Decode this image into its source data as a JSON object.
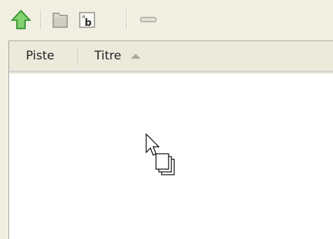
{
  "toolbar": {
    "buttons": [
      {
        "icon": "arrow-up-icon",
        "color": "#39a935"
      },
      {
        "icon": "folder-icon"
      },
      {
        "icon": "rename-ab-icon",
        "glyph_small": "a",
        "glyph_large": "b"
      },
      {
        "icon": "minus-icon"
      }
    ]
  },
  "list": {
    "columns": [
      {
        "label": "Piste"
      },
      {
        "label": "Titre",
        "sorted": "ascending"
      }
    ],
    "rows": []
  },
  "cursor": {
    "icon": "drag-multiple-files-cursor-icon"
  },
  "colors": {
    "background": "#f1efe2",
    "header": "#ebeadb",
    "list": "#ffffff",
    "accent_green": "#39a935"
  }
}
